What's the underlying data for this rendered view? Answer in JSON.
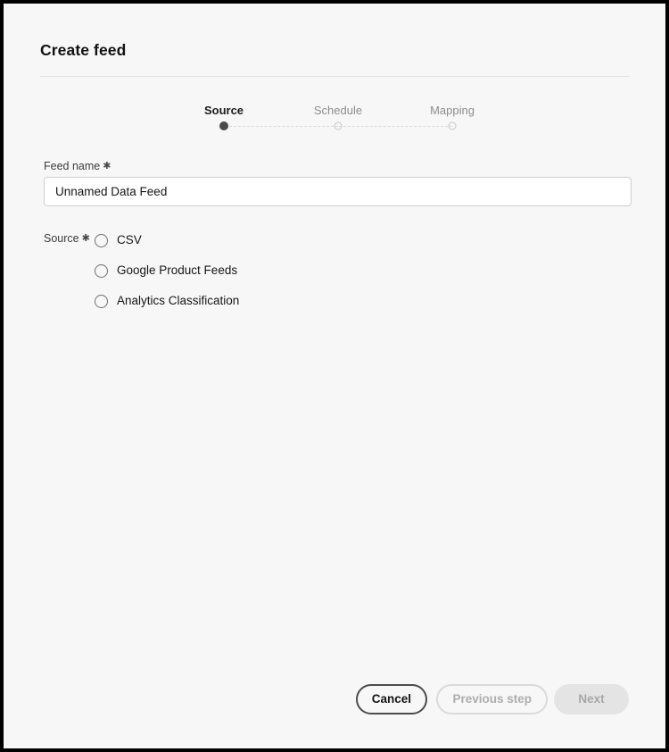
{
  "dialog": {
    "title": "Create feed"
  },
  "stepper": {
    "steps": [
      {
        "label": "Source",
        "state": "active"
      },
      {
        "label": "Schedule",
        "state": "inactive"
      },
      {
        "label": "Mapping",
        "state": "inactive"
      }
    ]
  },
  "feed_name": {
    "label": "Feed name",
    "required_mark": "✱",
    "value": "Unnamed Data Feed",
    "placeholder": "Unnamed Data Feed"
  },
  "source": {
    "label": "Source",
    "required_mark": "✱",
    "selected": null,
    "options": [
      {
        "label": "CSV",
        "checked": false
      },
      {
        "label": "Google Product Feeds",
        "checked": false
      },
      {
        "label": "Analytics Classification",
        "checked": false
      }
    ]
  },
  "footer": {
    "cancel_label": "Cancel",
    "previous_label": "Previous step",
    "next_label": "Next"
  },
  "colors": {
    "page_background": "#f7f7f7",
    "frame_border": "#000000",
    "text_primary": "#161616",
    "text_muted": "#8d8d8d",
    "divider": "#e1e1e1",
    "input_border": "#cfcfcf",
    "radio_border": "#6f6f6f",
    "button_disabled_fill": "#e4e4e4",
    "button_disabled_text": "#a7a7a7"
  }
}
